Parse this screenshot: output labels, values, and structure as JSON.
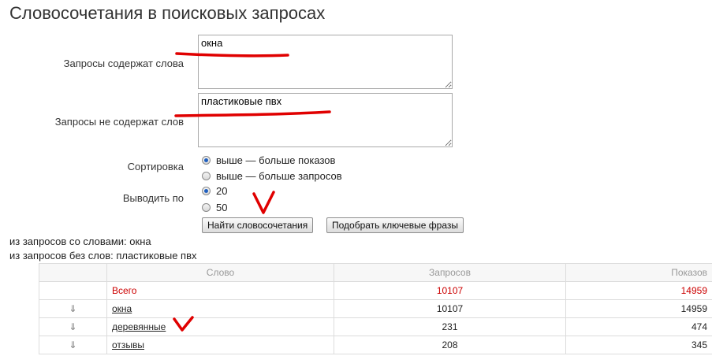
{
  "page": {
    "title": "Словосочетания в поисковых запросах"
  },
  "form": {
    "include_label": "Запросы содержат слова",
    "include_value": "окна",
    "exclude_label": "Запросы не содержат слов",
    "exclude_value": "пластиковые пвх",
    "sort_label": "Сортировка",
    "sort_options": [
      {
        "label": "выше — больше показов",
        "selected": true
      },
      {
        "label": "выше — больше запросов",
        "selected": false
      }
    ],
    "perpage_label": "Выводить по",
    "perpage_options": [
      {
        "label": "20",
        "selected": true
      },
      {
        "label": "50",
        "selected": false
      }
    ],
    "find_button": "Найти словосочетания",
    "keyphrases_button": "Подобрать ключевые фразы"
  },
  "info": {
    "with_words": "из запросов со словами: окна",
    "without_words": "из запросов без слов: пластиковые пвх"
  },
  "table": {
    "headers": {
      "arrow": "",
      "word": "Слово",
      "queries": "Запросов",
      "shows": "Показов"
    },
    "total": {
      "word": "Всего",
      "queries": "10107",
      "shows": "14959"
    },
    "rows": [
      {
        "arrow": "⇓",
        "word": "окна",
        "queries": "10107",
        "shows": "14959"
      },
      {
        "arrow": "⇓",
        "word": "деревянные",
        "queries": "231",
        "shows": "474"
      },
      {
        "arrow": "⇓",
        "word": "отзывы",
        "queries": "208",
        "shows": "345"
      }
    ]
  },
  "colors": {
    "annotation": "#e00000",
    "total_text": "#cc0000",
    "radio_selected": "#1f5fbf"
  }
}
